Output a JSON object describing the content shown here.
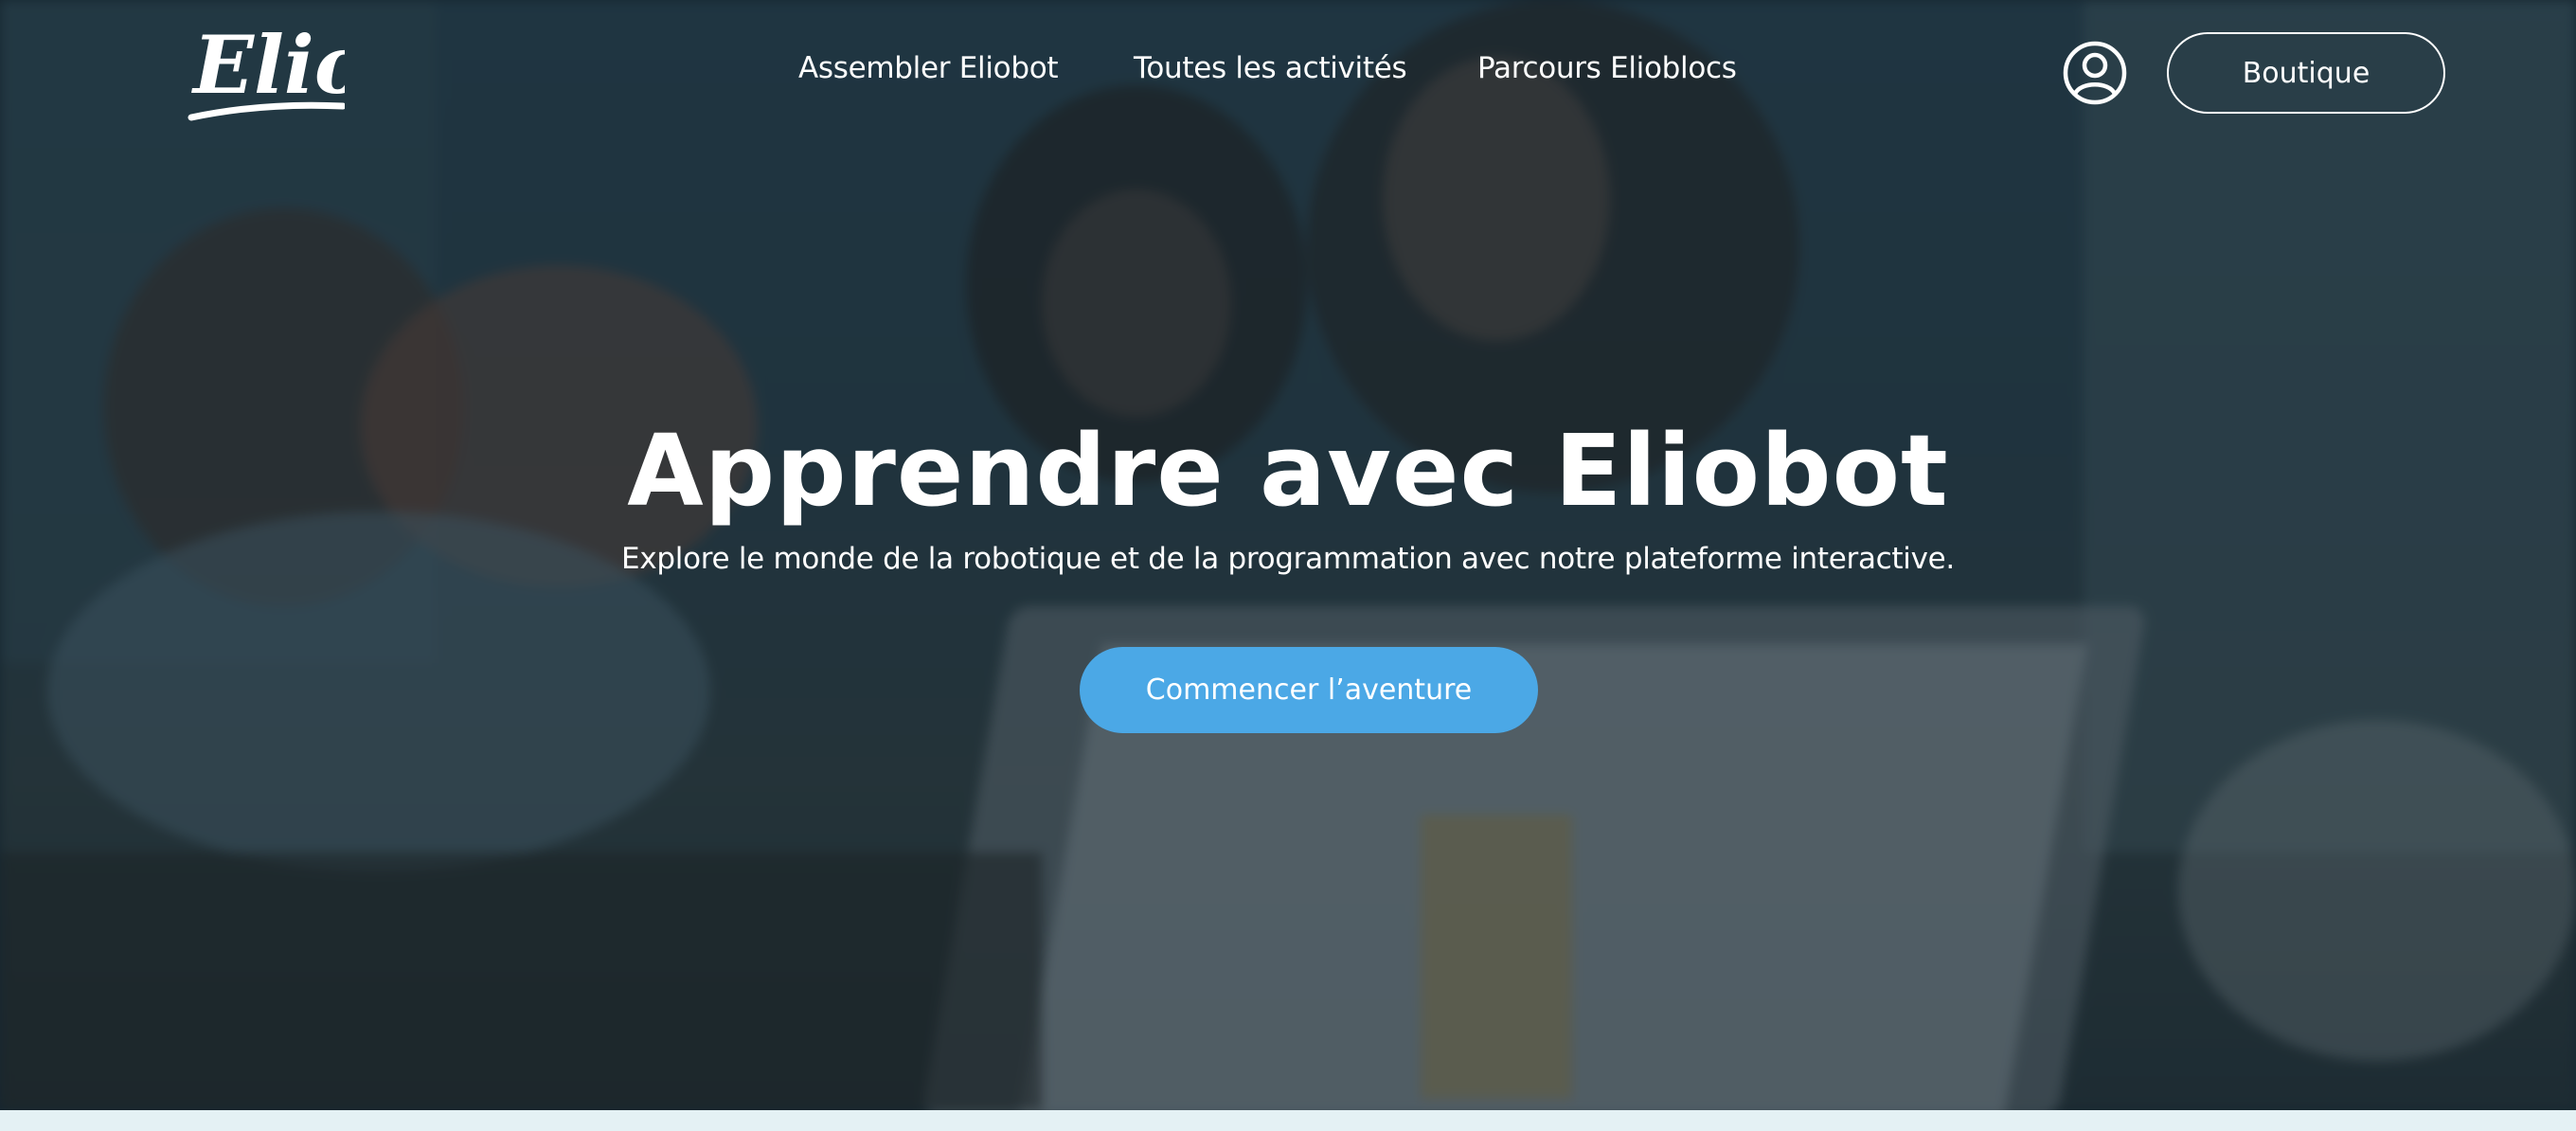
{
  "header": {
    "logo_text": "Elio",
    "nav": [
      {
        "label": "Assembler Eliobot"
      },
      {
        "label": "Toutes les activités"
      },
      {
        "label": "Parcours Elioblocs"
      }
    ],
    "account_icon": "user-circle-icon",
    "shop_label": "Boutique"
  },
  "hero": {
    "title": "Apprendre avec Eliobot",
    "subtitle": "Explore le monde de la robotique et de la programmation avec notre plateforme interactive.",
    "cta_label": "Commencer l’aventure"
  },
  "colors": {
    "accent": "#4ba8e6",
    "overlay": "#12202a",
    "text": "#ffffff",
    "bottom_strip": "#e4f1f4"
  }
}
